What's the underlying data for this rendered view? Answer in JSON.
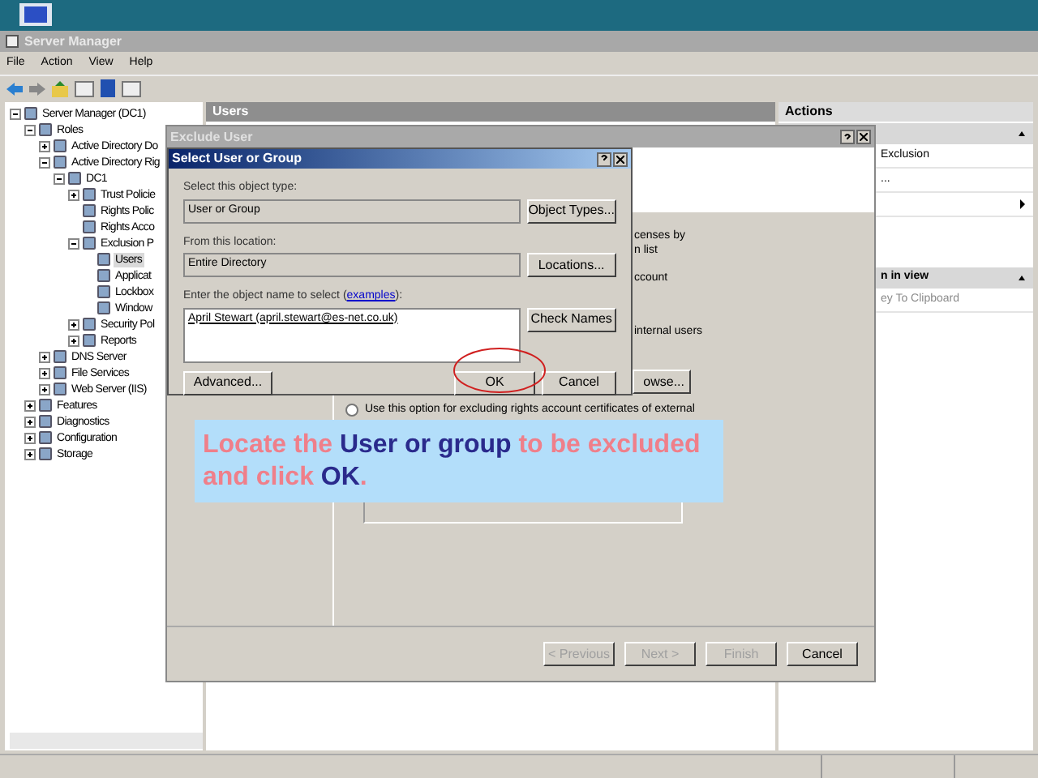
{
  "main_window": {
    "title": "Server Manager",
    "menu": [
      "File",
      "Action",
      "View",
      "Help"
    ],
    "tree": [
      {
        "label": "Server Manager (DC1)",
        "expanded": true,
        "selected": false,
        "children": [
          {
            "label": "Roles",
            "expanded": true,
            "selected": false,
            "children": [
              {
                "label": "Active Directory Do",
                "expanded": false,
                "selected": false
              },
              {
                "label": "Active Directory Rig",
                "expanded": true,
                "selected": false,
                "children": [
                  {
                    "label": "DC1",
                    "expanded": true,
                    "selected": false,
                    "children": [
                      {
                        "label": "Trust Policie",
                        "expanded": false,
                        "selected": false
                      },
                      {
                        "label": "Rights Polic",
                        "selected": false
                      },
                      {
                        "label": "Rights Acco",
                        "selected": false
                      },
                      {
                        "label": "Exclusion P",
                        "expanded": true,
                        "selected": false,
                        "children": [
                          {
                            "label": "Users",
                            "selected": true
                          },
                          {
                            "label": "Applicat",
                            "selected": false
                          },
                          {
                            "label": "Lockbox",
                            "selected": false
                          },
                          {
                            "label": "Window",
                            "selected": false
                          }
                        ]
                      },
                      {
                        "label": "Security Pol",
                        "expanded": false,
                        "selected": false
                      },
                      {
                        "label": "Reports",
                        "expanded": false,
                        "selected": false
                      }
                    ]
                  }
                ]
              },
              {
                "label": "DNS Server",
                "expanded": false,
                "selected": false
              },
              {
                "label": "File Services",
                "expanded": false,
                "selected": false
              },
              {
                "label": "Web Server (IIS)",
                "expanded": false,
                "selected": false
              }
            ]
          },
          {
            "label": "Features",
            "expanded": false,
            "selected": false
          },
          {
            "label": "Diagnostics",
            "expanded": false,
            "selected": false
          },
          {
            "label": "Configuration",
            "expanded": false,
            "selected": false
          },
          {
            "label": "Storage",
            "expanded": false,
            "selected": false
          }
        ]
      }
    ],
    "center_header": "Users",
    "actions": {
      "title": "Actions",
      "items": [
        {
          "kind": "header"
        },
        {
          "kind": "item",
          "label": "Exclusion",
          "disabled": false
        },
        {
          "kind": "item",
          "label": "...",
          "disabled": false
        },
        {
          "kind": "submenu"
        },
        {
          "kind": "spacer"
        },
        {
          "kind": "header",
          "label": "n in view"
        },
        {
          "kind": "item",
          "label": "ey To Clipboard",
          "disabled": true
        }
      ]
    }
  },
  "exclude_dialog": {
    "title": "Exclude User",
    "fragments": [
      "censes by",
      "n list",
      "ccount",
      "internal users"
    ],
    "browse_button": "owse...",
    "radio": {
      "label": "Use this option for excluding rights account certificates of external",
      "selected": false
    },
    "buttons": [
      {
        "label": "< Previous",
        "disabled": true
      },
      {
        "label": "Next >",
        "disabled": true
      },
      {
        "label": "Finish",
        "disabled": true
      },
      {
        "label": "Cancel",
        "disabled": false
      }
    ]
  },
  "select_dialog": {
    "title": "Select User or Group",
    "object_type_label": "Select this object type:",
    "object_type": "User or Group",
    "object_types_button": "Object Types...",
    "location_label": "From this location:",
    "location": "Entire Directory",
    "locations_button": "Locations...",
    "name_label": "Enter the object name to select (",
    "name_link": "examples",
    "name_label_end": "):",
    "name_value": "April Stewart (april.stewart@es-net.co.uk)",
    "check_names_button": "Check Names",
    "advanced_button": "Advanced...",
    "ok_button": "OK",
    "cancel_button": "Cancel",
    "ok_highlighted": true
  },
  "callout": [
    {
      "kind": "plain",
      "text": "Locate the "
    },
    {
      "kind": "key",
      "text": "User or group"
    },
    {
      "kind": "plain",
      "text": " to be excluded and click "
    },
    {
      "kind": "key",
      "text": "OK"
    },
    {
      "kind": "plain",
      "text": "."
    }
  ]
}
